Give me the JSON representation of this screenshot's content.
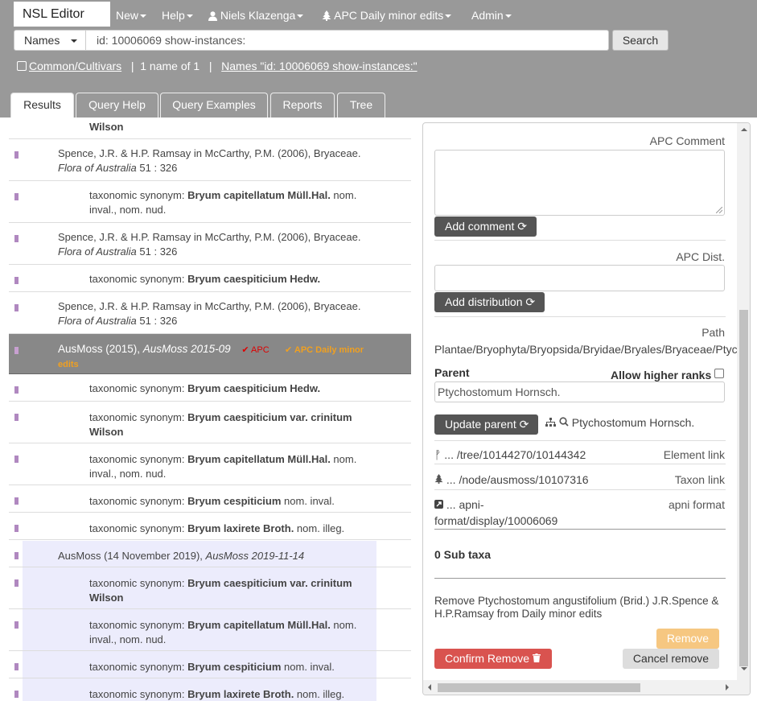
{
  "nav": {
    "brand": "NSL Editor",
    "new": "New",
    "help": "Help",
    "user": "Niels Klazenga",
    "tree": "APC Daily minor edits",
    "admin": "Admin"
  },
  "search": {
    "type": "Names",
    "query": "id: 10006069 show-instances:",
    "button": "Search"
  },
  "subbar": {
    "common": "Common/Cultivars",
    "sep1": "|",
    "count": "1 name of 1",
    "sep2": "|",
    "names_link": "Names \"id: 10006069 show-instances:\""
  },
  "tabs": [
    "Results",
    "Query Help",
    "Query Examples",
    "Reports",
    "Tree"
  ],
  "results": {
    "top_fragment": "Wilson",
    "rows": [
      {
        "ref": "Spence, J.R. & H.P. Ramsay in McCarthy, P.M. (2006), Bryaceae.",
        "ref2": "Flora of Australia",
        "page": " 51 : 326"
      },
      {
        "syn": "taxonomic synonym: ",
        "name": "Bryum capitellatum Müll.Hal.",
        "status": " nom.",
        "line2": "inval., nom. nud."
      },
      {
        "ref": "Spence, J.R. & H.P. Ramsay in McCarthy, P.M. (2006), Bryaceae.",
        "ref2": "Flora of Australia",
        "page": " 51 : 326"
      },
      {
        "syn": "taxonomic synonym: ",
        "name": "Bryum caespiticium Hedw."
      },
      {
        "ref": "Spence, J.R. & H.P. Ramsay in McCarthy, P.M. (2006), Bryaceae.",
        "ref2": "Flora of Australia",
        "page": " 51 : 326"
      },
      {
        "sel_ref": "AusMoss (2015), ",
        "sel_ital": "AusMoss 2015-09",
        "apc": "APC",
        "daily": "APC Daily minor",
        "daily2": "edits"
      },
      {
        "syn": "taxonomic synonym: ",
        "name": "Bryum caespiticium Hedw."
      },
      {
        "syn": "taxonomic synonym: ",
        "name": "Bryum caespiticium var. crinitum",
        "line2b": "Wilson"
      },
      {
        "syn": "taxonomic synonym: ",
        "name": "Bryum capitellatum Müll.Hal.",
        "status": " nom.",
        "line2": "inval., nom. nud."
      },
      {
        "syn": "taxonomic synonym: ",
        "name": "Bryum cespiticium",
        "status": " nom. inval."
      },
      {
        "syn": "taxonomic synonym: ",
        "name": "Bryum laxirete Broth.",
        "status": " nom. illeg."
      },
      {
        "ref": "AusMoss (14 November 2019), ",
        "ital": "AusMoss 2019-11-14"
      },
      {
        "syn": "taxonomic synonym: ",
        "name": "Bryum caespiticium var. crinitum",
        "line2b": "Wilson"
      },
      {
        "syn": "taxonomic synonym: ",
        "name": "Bryum capitellatum Müll.Hal.",
        "status": " nom.",
        "line2": "inval., nom. nud."
      },
      {
        "syn": "taxonomic synonym: ",
        "name": "Bryum cespiticium",
        "status": " nom. inval."
      },
      {
        "syn": "taxonomic synonym: ",
        "name": "Bryum laxirete Broth.",
        "status": " nom. illeg."
      }
    ]
  },
  "panel": {
    "apc_comment_label": "APC Comment",
    "add_comment": "Add comment",
    "apc_dist_label": "APC Dist.",
    "add_distribution": "Add distribution",
    "path_label": "Path",
    "path_value": "Plantae/Bryophyta/Bryopsida/Bryidae/Bryales/Bryaceae/Ptychostomum",
    "parent_label": "Parent",
    "allow_higher": "Allow higher ranks",
    "parent_value": "Ptychostomum Hornsch.",
    "update_parent": "Update parent",
    "parent_link": "Ptychostomum Hornsch.",
    "element_link_value": "... /tree/10144270/10144342",
    "element_link_label": "Element link",
    "taxon_link_value": "... /node/ausmoss/10107316",
    "taxon_link_label": "Taxon link",
    "apni_value_1": "... apni-",
    "apni_value_2": "format/display/10006069",
    "apni_label": "apni format",
    "sub_taxa": "0 Sub taxa",
    "remove_text": "Remove Ptychostomum angustifolium (Brid.) J.R.Spence & H.P.Ramsay from Daily minor edits",
    "remove_btn": "Remove",
    "confirm_remove": "Confirm Remove",
    "cancel_remove": "Cancel remove"
  },
  "colors": {
    "header": "#999999",
    "selected_row": "#888888",
    "marker": "#b088c0",
    "confirm": "#d9534f",
    "remove_disabled": "#f0ad4e"
  }
}
